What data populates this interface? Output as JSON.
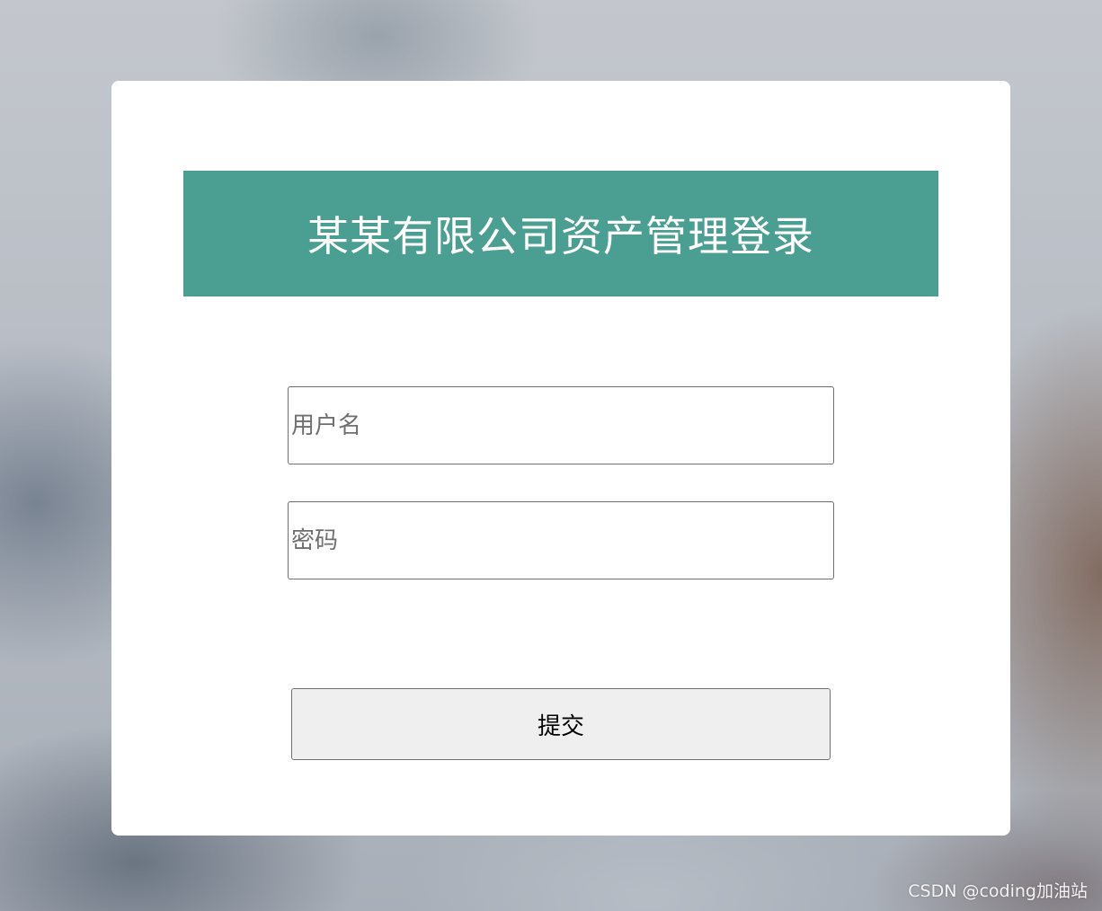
{
  "login": {
    "title": "某某有限公司资产管理登录",
    "username": {
      "placeholder": "用户名",
      "value": ""
    },
    "password": {
      "placeholder": "密码",
      "value": ""
    },
    "submit_label": "提交"
  },
  "watermark": "CSDN @coding加油站",
  "colors": {
    "title_bar": "#4a9e92",
    "card": "#ffffff",
    "button_bg": "#efefef"
  }
}
